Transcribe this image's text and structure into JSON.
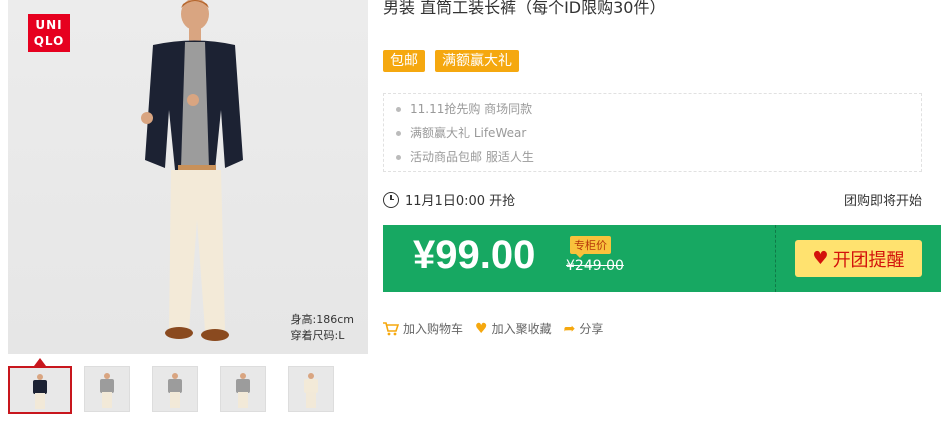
{
  "product": {
    "title": "男装 直筒工装长裤（每个ID限购30件）",
    "brand_logo_line1": "UNI",
    "brand_logo_line2": "QLO",
    "model_height": "身高:186cm",
    "model_size": "穿着尺码:L"
  },
  "tags": [
    "包邮",
    "满额赢大礼"
  ],
  "promotions": [
    "11.11抢先购 商场同款",
    "满额赢大礼 LifeWear",
    "活动商品包邮 服适人生"
  ],
  "timer": {
    "start_time": "11月1日0:00 开抢",
    "status": "团购即将开始"
  },
  "price": {
    "current": "¥99.00",
    "counter_label": "专柜价",
    "original": "¥249.00",
    "remind_button": "开团提醒"
  },
  "actions": {
    "add_cart": "加入购物车",
    "favorite": "加入聚收藏",
    "share": "分享"
  },
  "colors": {
    "price_bar": "#17a862",
    "tag": "#f5a80f",
    "remind": "#ffe26f",
    "brand": "#e6001f"
  }
}
